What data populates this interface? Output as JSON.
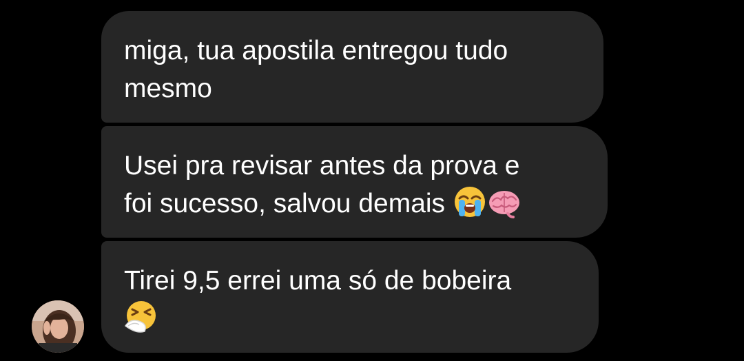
{
  "messages": [
    {
      "text": "miga, tua apostila entregou tudo\nmesmo",
      "emojis": []
    },
    {
      "text": "Usei pra revisar antes da prova e\nfoi sucesso, salvou demais ",
      "emojis": [
        "loudly-crying-face-emoji",
        "brain-emoji"
      ]
    },
    {
      "text": "Tirei 9,5 errei uma só de bobeira\n",
      "emojis": [
        "sneezing-face-emoji"
      ]
    }
  ],
  "avatar": {
    "icon": "sender-avatar-photo"
  },
  "colors": {
    "background": "#000000",
    "bubble": "#262626",
    "text": "#ffffff"
  }
}
